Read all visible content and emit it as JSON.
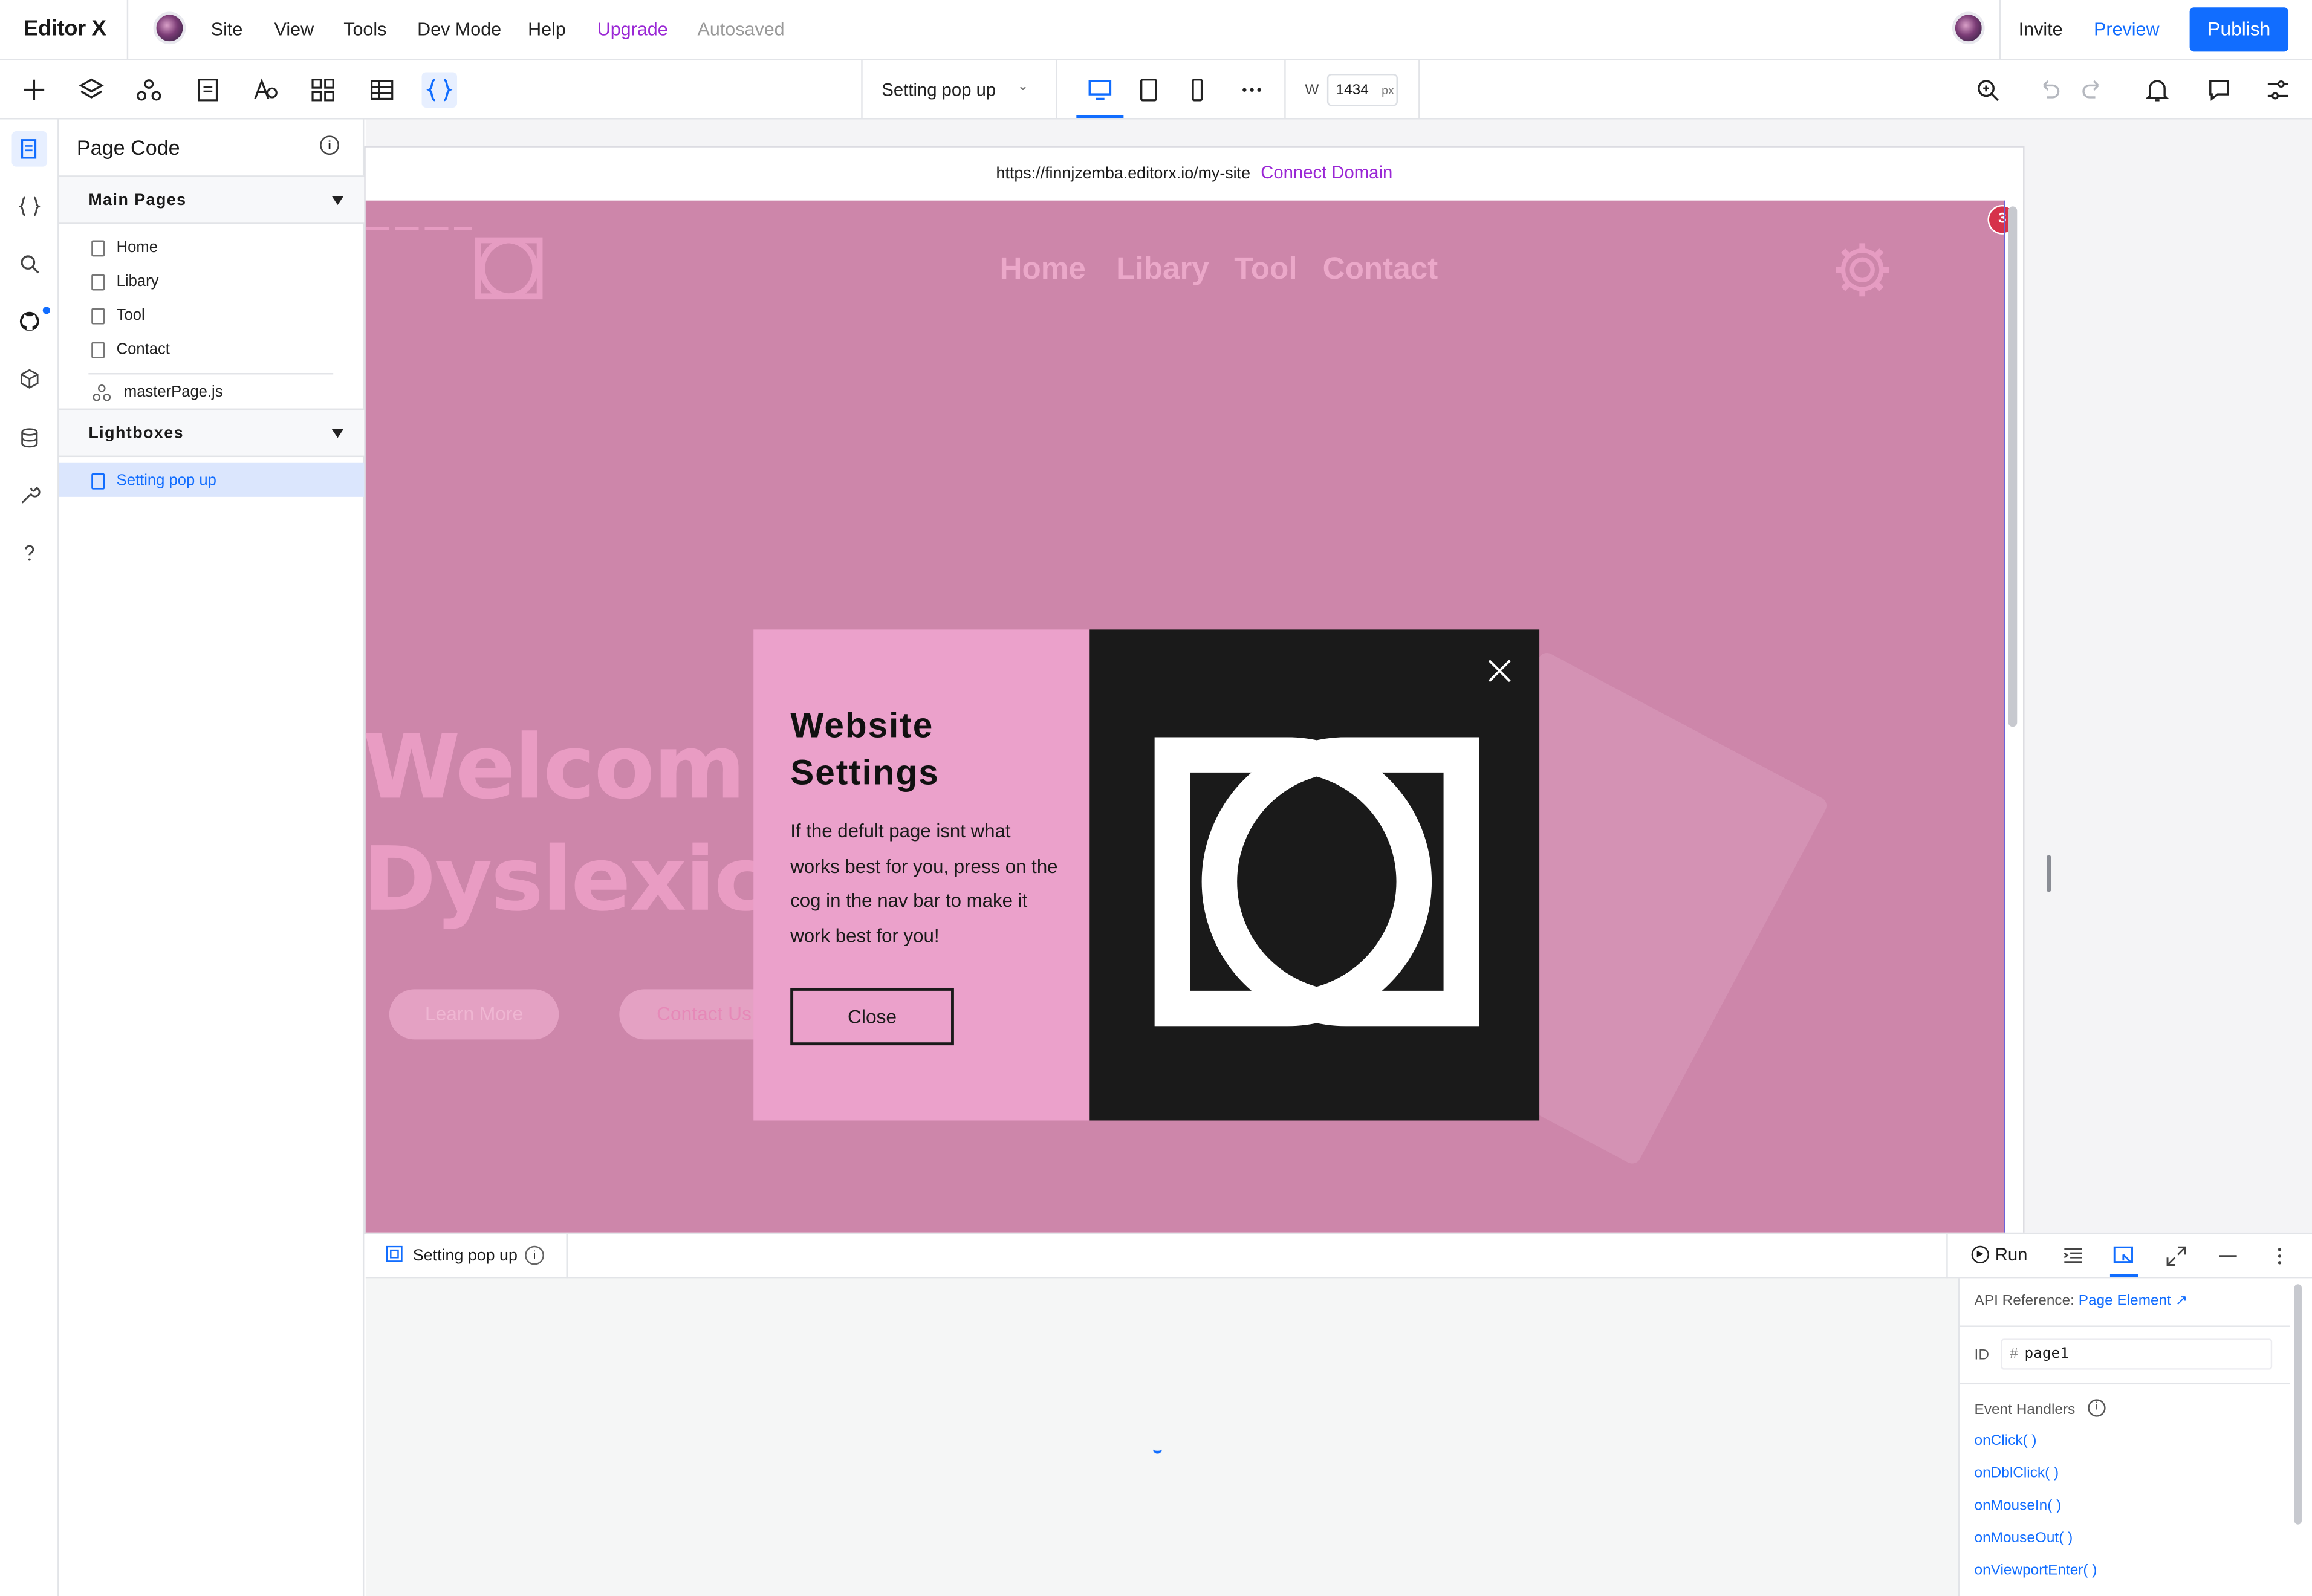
{
  "app": {
    "brand": "Editor X"
  },
  "menu": {
    "site": "Site",
    "view": "View",
    "tools": "Tools",
    "dev_mode": "Dev Mode",
    "help": "Help",
    "upgrade": "Upgrade",
    "autosaved": "Autosaved"
  },
  "actions": {
    "invite": "Invite",
    "preview": "Preview",
    "publish": "Publish"
  },
  "toolbar": {
    "page_select": "Setting pop up",
    "width_label": "W",
    "width_value": "1434",
    "width_unit": "px"
  },
  "panel": {
    "title": "Page Code",
    "main_pages_label": "Main Pages",
    "pages": [
      {
        "label": "Home"
      },
      {
        "label": "Libary"
      },
      {
        "label": "Tool"
      },
      {
        "label": "Contact"
      }
    ],
    "master_page": "masterPage.js",
    "lightboxes_label": "Lightboxes",
    "lightboxes": [
      {
        "label": "Setting pop up"
      }
    ]
  },
  "stage": {
    "url": "https://finnjzemba.editorx.io/my-site",
    "connect_domain": "Connect Domain",
    "badge_count": "3"
  },
  "site": {
    "nav": [
      "Home",
      "Libary",
      "Tool",
      "Contact"
    ],
    "hero_line1": "Welcom",
    "hero_line2": "Dyslexic",
    "btn_learn": "Learn More",
    "btn_contact": "Contact Us"
  },
  "modal": {
    "title": "Website Settings",
    "body": "If the defult page isnt what works best for you, press on the cog in the nav bar to make it work best for you!",
    "close_label": "Close"
  },
  "code_panel": {
    "tab_label": "Setting pop up",
    "run_label": "Run",
    "api_ref_label": "API Reference:",
    "api_ref_link": "Page Element",
    "id_label": "ID",
    "id_value": "page1",
    "handlers_label": "Event Handlers",
    "handlers": [
      "onClick( )",
      "onDblClick( )",
      "onMouseIn( )",
      "onMouseOut( )",
      "onViewportEnter( )"
    ]
  },
  "colors": {
    "accent": "#116dff",
    "upgrade": "#9a27d5",
    "site_bg": "#cd86aa",
    "modal_pink": "#eba1cb",
    "modal_dark": "#1a1a1a"
  }
}
